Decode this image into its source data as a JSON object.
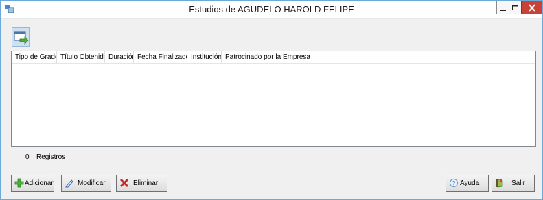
{
  "window": {
    "title": "Estudios de AGUDELO  HAROLD FELIPE"
  },
  "toolbar": {
    "export_icon": "export-window-icon"
  },
  "grid": {
    "columns": [
      "Tipo de Grado",
      "Título Obtenido",
      "Duración",
      "Fecha Finalizado",
      "Institución",
      "Patrocinado por la Empresa"
    ],
    "rows": []
  },
  "records": {
    "count": "0",
    "label": "Registros"
  },
  "buttons": {
    "add": "Adicionar",
    "modify": "Modificar",
    "delete": "Eliminar",
    "help": "Ayuda",
    "exit": "Salir"
  }
}
